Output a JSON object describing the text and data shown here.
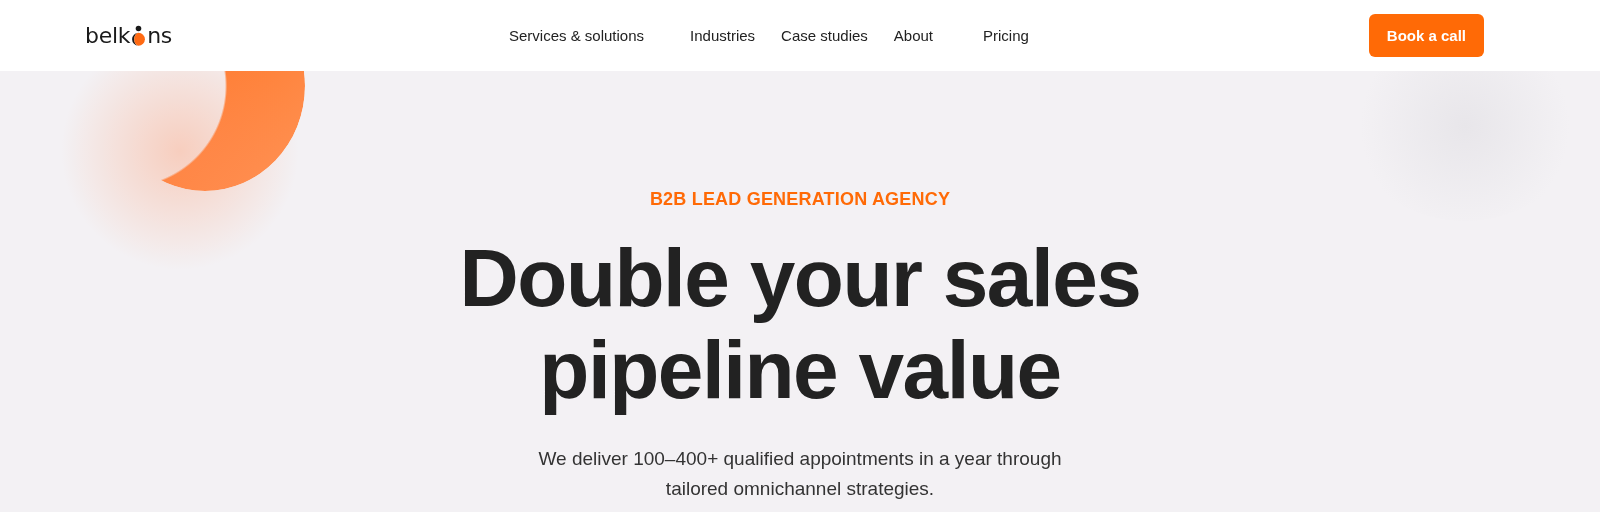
{
  "header": {
    "logo": {
      "before": "belk",
      "after": "ns"
    },
    "nav": [
      {
        "label": "Services & solutions"
      },
      {
        "label": "Industries"
      },
      {
        "label": "Case studies"
      },
      {
        "label": "About"
      },
      {
        "label": "Pricing"
      }
    ],
    "cta": "Book a call"
  },
  "hero": {
    "eyebrow": "B2B LEAD GENERATION AGENCY",
    "title_lines": [
      "Double your sales",
      "pipeline value"
    ],
    "subtitle_lines": [
      "We deliver 100–400+ qualified appointments in a year through",
      "tailored omnichannel strategies."
    ]
  }
}
